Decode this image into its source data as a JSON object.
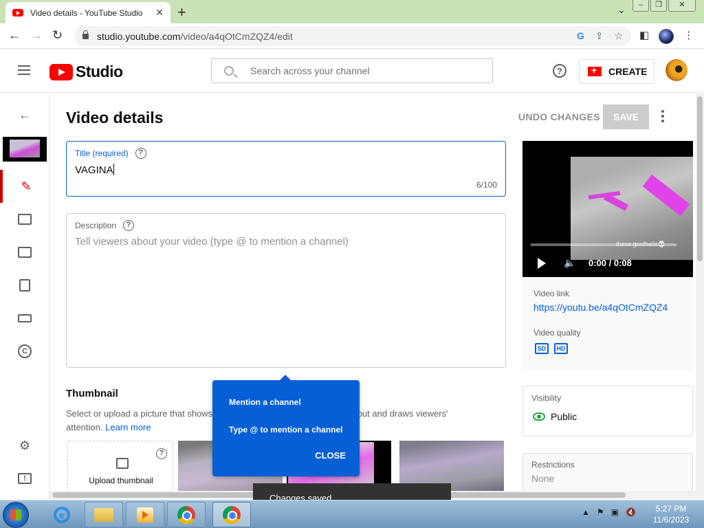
{
  "browser": {
    "tab_title": "Video details - YouTube Studio",
    "url_host": "studio.youtube.com",
    "url_path": "/video/a4qOtCmZQZ4/edit"
  },
  "header": {
    "logo_text": "Studio",
    "search_placeholder": "Search across your channel",
    "create_label": "CREATE"
  },
  "page": {
    "title": "Video details",
    "undo_label": "UNDO CHANGES",
    "save_label": "SAVE"
  },
  "title_field": {
    "label": "Title (required)",
    "value": "VAGINA",
    "counter": "6/100"
  },
  "description_field": {
    "label": "Description",
    "placeholder": "Tell viewers about your video (type @ to mention a channel)"
  },
  "thumbnail": {
    "heading": "Thumbnail",
    "description_start": "Select or upload a picture that shows",
    "description_end": "ail stands out and draws viewers'",
    "description_line2": "attention.",
    "learn_more": "Learn more",
    "upload_label": "Upload thumbnail"
  },
  "video_panel": {
    "time": "0:00 / 0:08",
    "watermark": "these goofballs💀",
    "link_label": "Video link",
    "link": "https://youtu.be/a4qOtCmZQZ4",
    "quality_label": "Video quality",
    "quality_sd": "SD",
    "quality_hd": "HD",
    "visibility_label": "Visibility",
    "visibility_value": "Public",
    "restrictions_label": "Restrictions",
    "restrictions_value": "None"
  },
  "popup": {
    "heading": "Mention a channel",
    "body": "Type @ to mention a channel",
    "close_label": "CLOSE"
  },
  "toast": {
    "text": "Changes saved"
  },
  "taskbar": {
    "time": "5:27 PM",
    "date": "11/6/2023"
  },
  "colors": {
    "brand_red": "#ff0000",
    "accent_blue": "#065fd4",
    "public_green": "#2ba640"
  }
}
